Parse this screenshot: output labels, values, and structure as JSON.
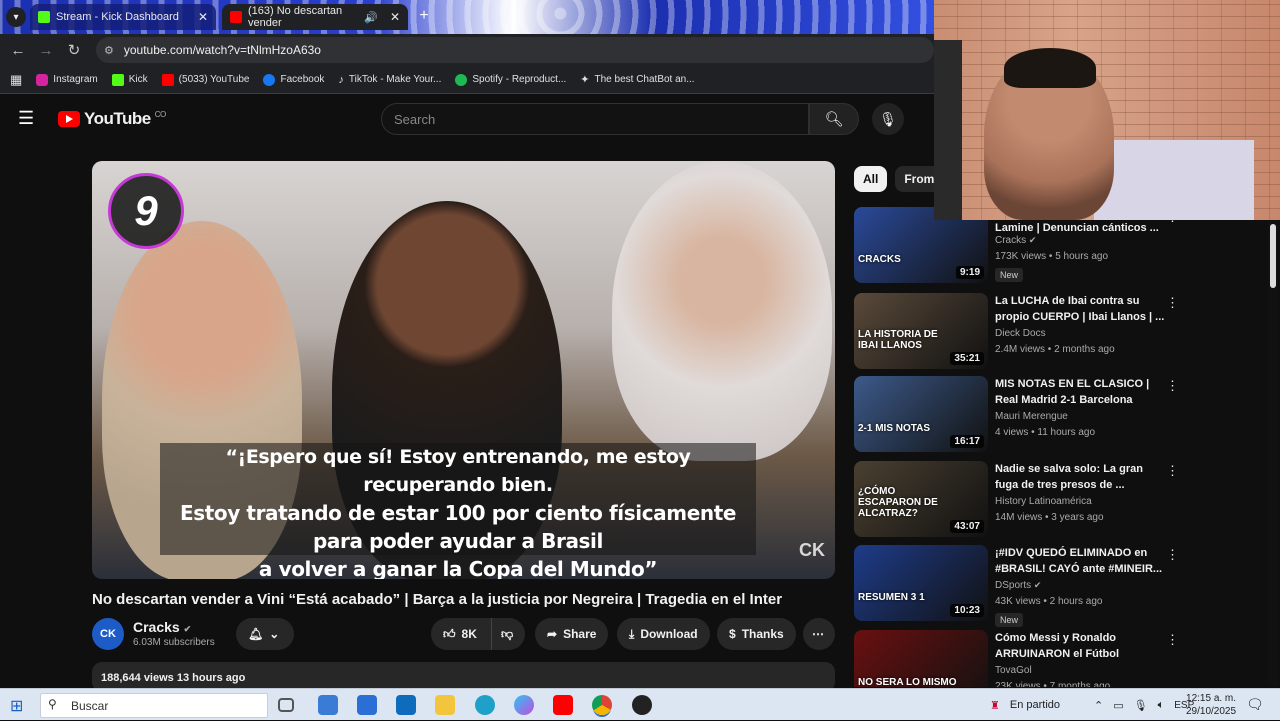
{
  "browser": {
    "tabs": [
      {
        "label": "Stream - Kick Dashboard",
        "color": "#53fc18"
      },
      {
        "label": "(163) No descartan vender",
        "color": "#ff0000"
      }
    ],
    "address": "youtube.com/watch?v=tNlmHzoA63o",
    "bookmarks": [
      {
        "label": "Instagram",
        "color": "#d6249f"
      },
      {
        "label": "Kick",
        "color": "#53fc18"
      },
      {
        "label": "(5033) YouTube",
        "color": "#ff0000"
      },
      {
        "label": "Facebook",
        "color": "#1877f2"
      },
      {
        "label": "TikTok - Make Your...",
        "color": "#ffffff"
      },
      {
        "label": "Spotify - Reproduct...",
        "color": "#1db954"
      },
      {
        "label": "The best ChatBot an...",
        "color": "#ffffff"
      }
    ]
  },
  "youtube": {
    "logo_text": "YouTube",
    "country": "CO",
    "search_placeholder": "Search"
  },
  "video": {
    "badge": "9",
    "caption_lines": [
      "“¡Espero que sí! Estoy entrenando, me estoy recuperando bien.",
      "Estoy tratando de estar 100 por ciento físicamente",
      "para poder ayudar a Brasil",
      "a volver a ganar la Copa del Mundo”"
    ],
    "watermark": "CK",
    "title": "No descartan vender a Vini “Está acabado” | Barça a la justicia por Negreira | Tragedia en el Inter",
    "channel": {
      "avatar": "CK",
      "name": "Cracks",
      "subscribers": "6.03M subscribers"
    },
    "likes": "8K",
    "share_label": "Share",
    "download_label": "Download",
    "thanks_label": "Thanks",
    "views_date": "188,644 views  13 hours ago"
  },
  "sidebar": {
    "chips": [
      "All",
      "From C"
    ],
    "recommendations": [
      {
        "title": "Lamine | Denuncian cánticos ...",
        "channel": "Cracks",
        "verified": true,
        "meta": "173K views • 5 hours ago",
        "new": true,
        "duration": "9:19",
        "thumb": "#2a4a9a"
      },
      {
        "title": "La LUCHA de Ibai contra su propio CUERPO | Ibai Llanos | ...",
        "channel": "Dieck Docs",
        "verified": false,
        "meta": "2.4M views • 2 months ago",
        "new": false,
        "duration": "35:21",
        "thumb": "#5a4a3a"
      },
      {
        "title": "MIS NOTAS EN EL CLASICO | Real Madrid 2-1 Barcelona",
        "channel": "Mauri Merengue",
        "verified": false,
        "meta": "4 views • 11 hours ago",
        "new": false,
        "duration": "16:17",
        "thumb": "#3c5a8a"
      },
      {
        "title": "Nadie se salva solo: La gran fuga de tres presos de ...",
        "channel": "History Latinoamérica",
        "verified": false,
        "meta": "14M views • 3 years ago",
        "new": false,
        "duration": "43:07",
        "thumb": "#4a4030"
      },
      {
        "title": "¡#IDV QUEDÓ ELIMINADO en #BRASIL! CAYÓ ante #MINEIR...",
        "channel": "DSports",
        "verified": true,
        "meta": "43K views • 2 hours ago",
        "new": true,
        "duration": "10:23",
        "thumb": "#1e3c8a"
      },
      {
        "title": "Cómo Messi y Ronaldo ARRUINARON el Fútbol",
        "channel": "TovaGol",
        "verified": false,
        "meta": "23K views • 7 months ago",
        "new": false,
        "duration": "",
        "thumb": "#6a1010"
      }
    ],
    "thumb_texts": [
      "CRACKS",
      "LA HISTORIA DE IBAI LLANOS",
      "2-1 MIS NOTAS",
      "¿CÓMO ESCAPARON DE ALCATRAZ?",
      "RESUMEN 3 1",
      "NO SERA LO MISMO"
    ],
    "new_label": "New"
  },
  "taskbar": {
    "search_placeholder": "Buscar",
    "status": "En partido",
    "lang": "ESP",
    "time": "12:15 a. m.",
    "date": "29/10/2025"
  }
}
